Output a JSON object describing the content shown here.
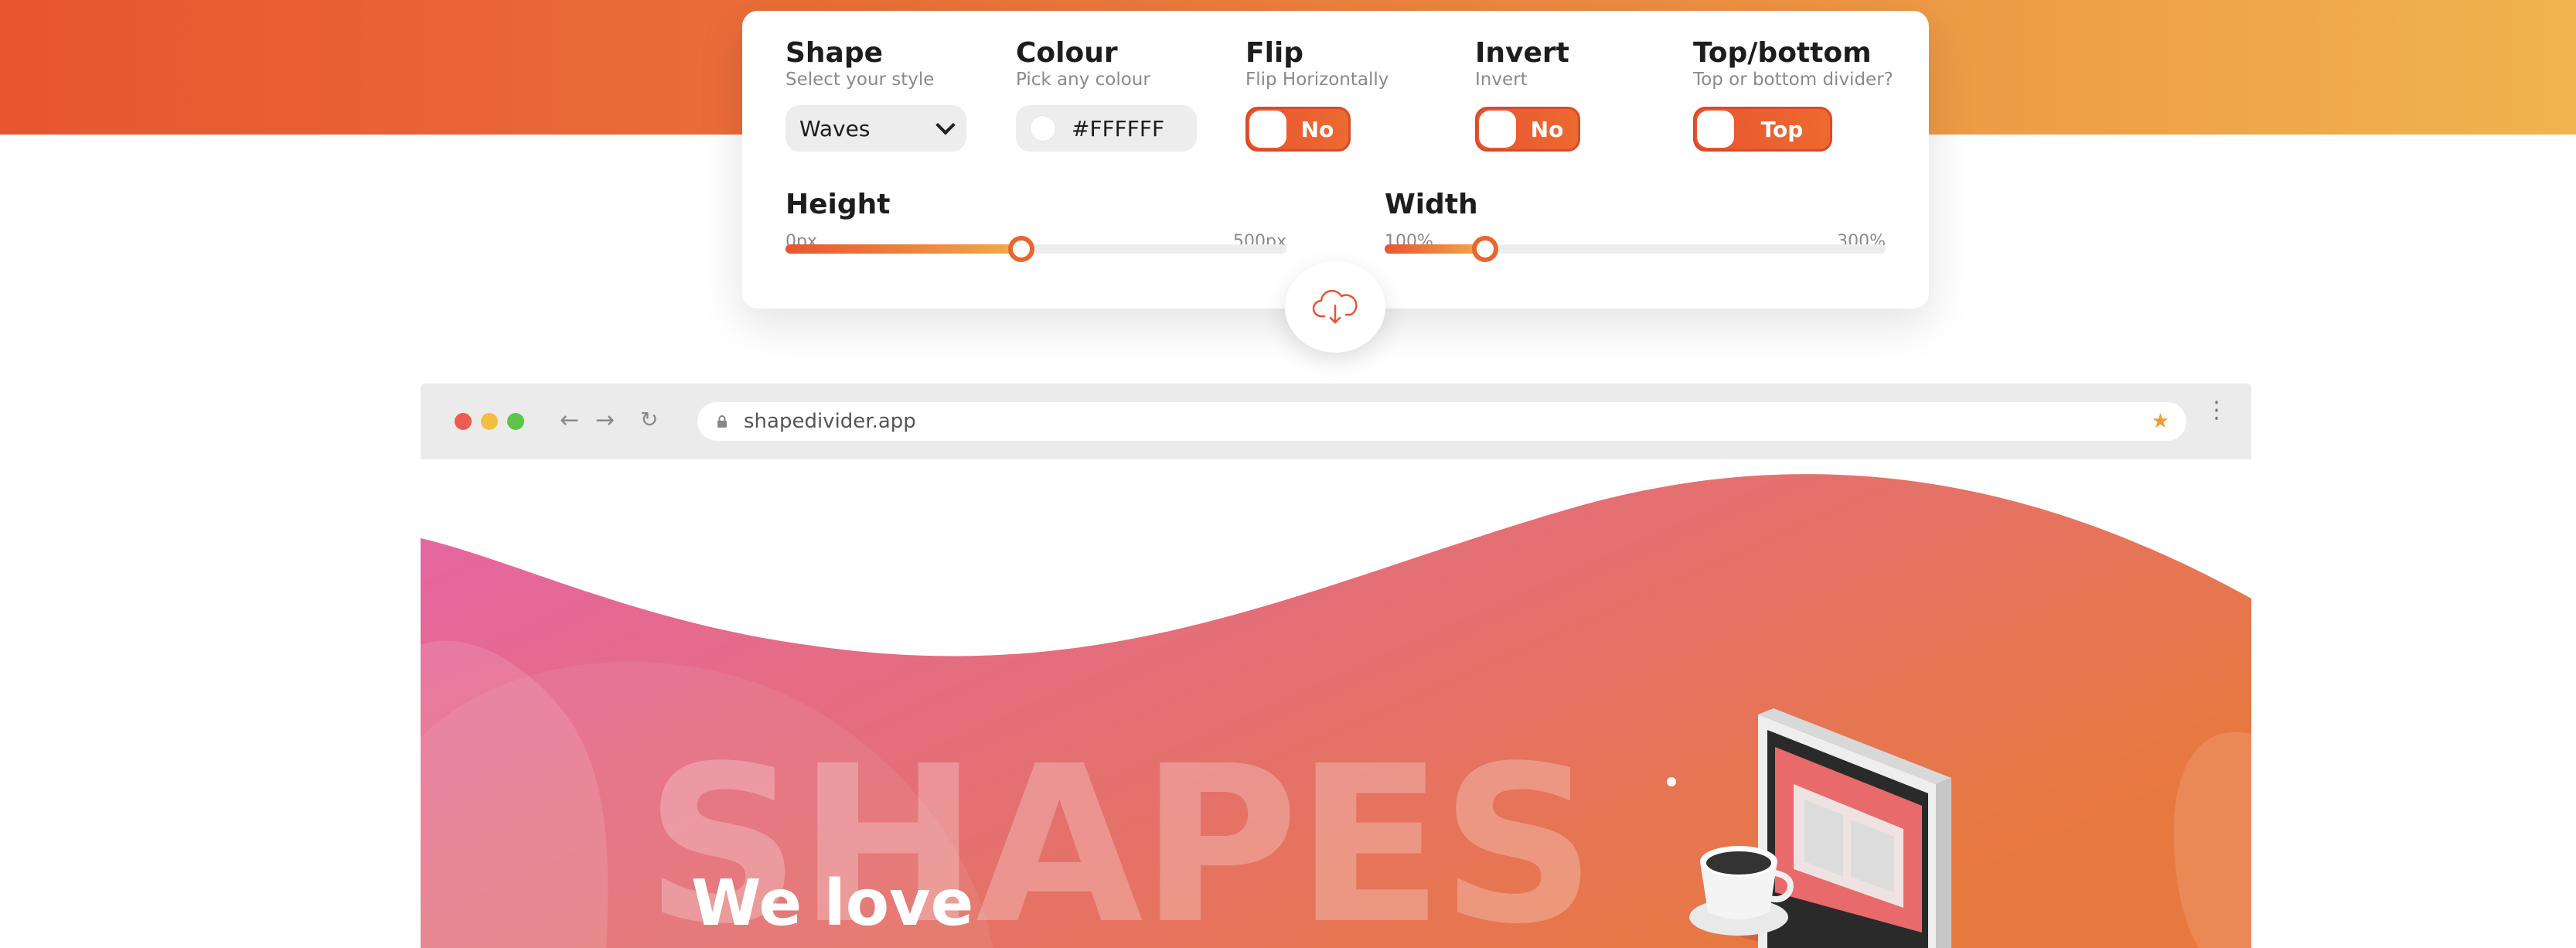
{
  "controls": {
    "shape": {
      "title": "Shape",
      "subtitle": "Select your style",
      "value": "Waves"
    },
    "colour": {
      "title": "Colour",
      "subtitle": "Pick any colour",
      "value": "#FFFFFF"
    },
    "flip": {
      "title": "Flip",
      "subtitle": "Flip Horizontally",
      "value": "No"
    },
    "invert": {
      "title": "Invert",
      "subtitle": "Invert",
      "value": "No"
    },
    "top_bottom": {
      "title": "Top/bottom",
      "subtitle": "Top or bottom divider?",
      "value": "Top"
    },
    "height": {
      "title": "Height",
      "min_label": "0px",
      "max_label": "500px",
      "level_fraction": 0.47
    },
    "width": {
      "title": "Width",
      "min_label": "100%",
      "max_label": "300%",
      "level_fraction": 0.2
    }
  },
  "download_icon": "cloud-download-icon",
  "browser": {
    "url": "shapedivider.app",
    "dots": [
      "#ee5b52",
      "#f4bd3f",
      "#5dc548"
    ]
  },
  "hero": {
    "headline": "SHAPES",
    "subheadline": "We love"
  },
  "colors": {
    "accent": "#e8552f",
    "accent_light": "#f0ad4a",
    "hero_pink": "#e664a8",
    "hero_orange": "#e8793e"
  }
}
